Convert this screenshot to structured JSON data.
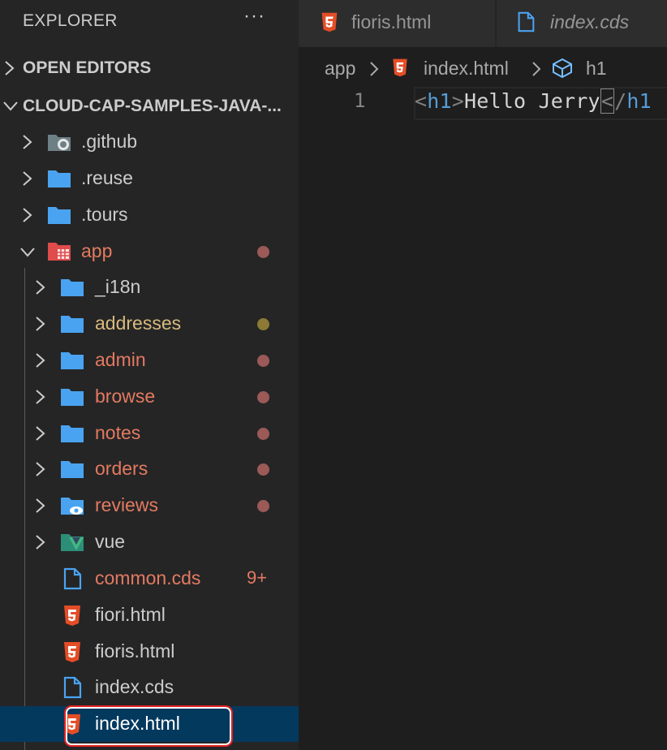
{
  "sidebar": {
    "title": "EXPLORER",
    "more": "···",
    "sections": {
      "open_editors": "OPEN EDITORS",
      "project": "CLOUD-CAP-SAMPLES-JAVA-..."
    },
    "tree": {
      "github": ".github",
      "reuse": ".reuse",
      "tours": ".tours",
      "app": "app",
      "i18n": "_i18n",
      "addresses": "addresses",
      "admin": "admin",
      "browse": "browse",
      "notes": "notes",
      "orders": "orders",
      "reviews": "reviews",
      "vue": "vue",
      "common_cds": "common.cds",
      "common_cds_badge": "9+",
      "fiori_html": "fiori.html",
      "fioris_html": "fioris.html",
      "index_cds": "index.cds",
      "index_html": "index.html"
    }
  },
  "tabs": [
    {
      "label": "fioris.html"
    },
    {
      "label": "index.cds"
    }
  ],
  "breadcrumb": {
    "folder": "app",
    "file": "index.html",
    "symbol": "h1"
  },
  "editor": {
    "line_number": "1",
    "open_lt": "<",
    "open_tag": "h1",
    "open_gt": ">",
    "text": "Hello Jerry",
    "close_lt": "<",
    "close_slash": "/",
    "close_tag": "h1"
  },
  "colors": {
    "modified": "#e37a60",
    "untracked": "#d7ba7d",
    "folder": "#4aa3f0",
    "html": "#e44d26",
    "selection": "#04395e"
  }
}
